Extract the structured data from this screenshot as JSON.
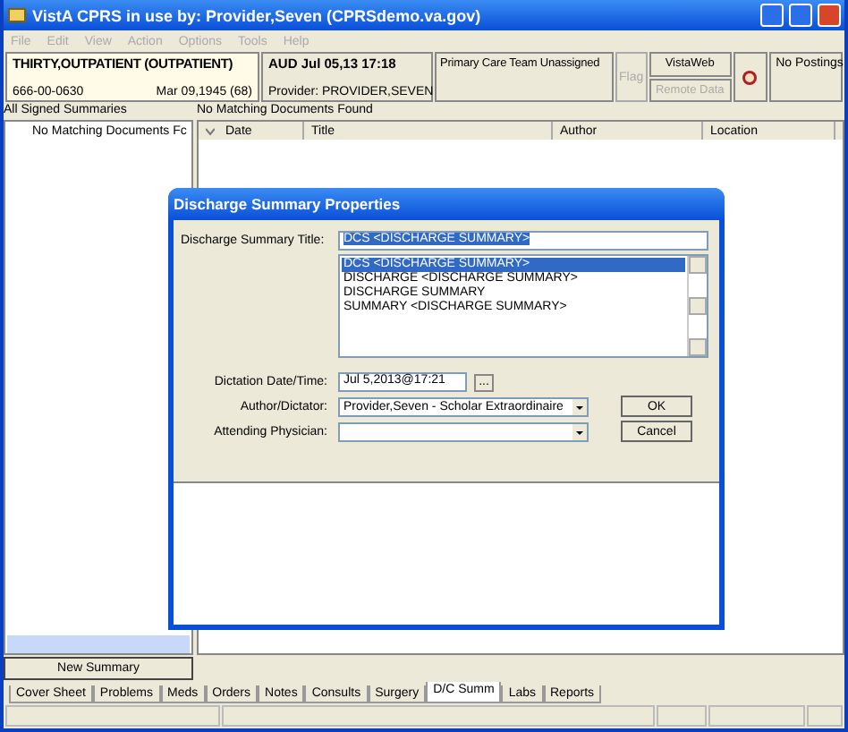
{
  "window": {
    "title": "VistA CPRS in use by: Provider,Seven  (CPRSdemo.va.gov)"
  },
  "menu": [
    {
      "label": "File",
      "disabled": true
    },
    {
      "label": "Edit",
      "disabled": true
    },
    {
      "label": "View",
      "disabled": true
    },
    {
      "label": "Action",
      "disabled": true
    },
    {
      "label": "Options",
      "disabled": true
    },
    {
      "label": "Tools",
      "disabled": true
    },
    {
      "label": "Help",
      "disabled": true
    }
  ],
  "header": {
    "patient": "THIRTY,OUTPATIENT (OUTPATIENT)",
    "ssn": "666-00-0630",
    "dob": "Mar 09,1945 (68)",
    "encounter": "AUD Jul 05,13 17:18",
    "provider": "Provider:  PROVIDER,SEVEN",
    "team": "Primary Care Team Unassigned",
    "buttons": [
      {
        "label": "Flag",
        "disabled": true
      },
      {
        "label": "VistaWeb",
        "disabled": false
      },
      {
        "label": "Remote Data",
        "disabled": true
      }
    ],
    "postings": "No Postings"
  },
  "left": {
    "label": "All Signed Summaries",
    "tree_item": "No Matching Documents Fc",
    "button": "New Summary"
  },
  "right": {
    "label": "No Matching Documents Found",
    "columns": [
      "Date",
      "Title",
      "Author",
      "Location"
    ]
  },
  "tabs": [
    {
      "label": "Cover Sheet",
      "selected": false
    },
    {
      "label": "Problems",
      "selected": false
    },
    {
      "label": "Meds",
      "selected": false
    },
    {
      "label": "Orders",
      "selected": false
    },
    {
      "label": "Notes",
      "selected": false
    },
    {
      "label": "Consults",
      "selected": false
    },
    {
      "label": "Surgery",
      "selected": false
    },
    {
      "label": "D/C Summ",
      "selected": true
    },
    {
      "label": "Labs",
      "selected": false
    },
    {
      "label": "Reports",
      "selected": false
    }
  ],
  "dialog": {
    "title": "Discharge Summary Properties",
    "title_label": "Discharge Summary Title:",
    "title_value": "DCS  <DISCHARGE SUMMARY>",
    "title_options": [
      {
        "label": "DCS  <DISCHARGE SUMMARY>",
        "selected": true
      },
      {
        "label": "DISCHARGE  <DISCHARGE SUMMARY>",
        "selected": false
      },
      {
        "label": "DISCHARGE SUMMARY",
        "selected": false
      },
      {
        "label": "SUMMARY  <DISCHARGE SUMMARY>",
        "selected": false
      }
    ],
    "date_label": "Dictation Date/Time:",
    "date_value": "Jul 5,2013@17:21",
    "date_button": "...",
    "author_label": "Author/Dictator:",
    "author_value": "Provider,Seven - Scholar Extraordinaire",
    "attending_label": "Attending Physician:",
    "ok": "OK",
    "cancel": "Cancel"
  }
}
